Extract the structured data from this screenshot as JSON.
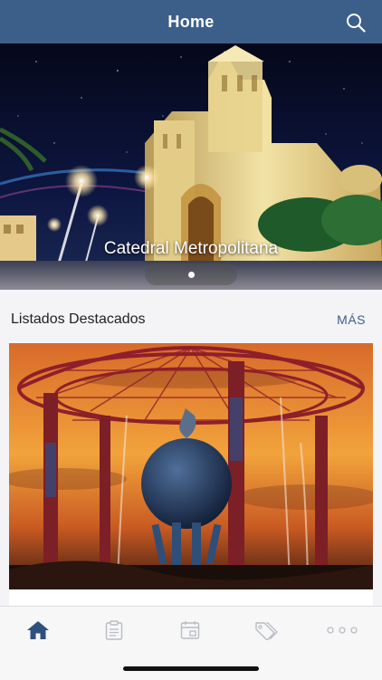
{
  "header": {
    "title": "Home",
    "search_icon": "search-icon"
  },
  "hero": {
    "caption": "Catedral Metropolitana",
    "slides_shown": 1
  },
  "featured": {
    "title": "Listados Destacados",
    "more_label": "MÁS"
  },
  "tabbar": {
    "items": [
      {
        "icon": "home-icon",
        "active": true
      },
      {
        "icon": "clipboard-icon",
        "active": false
      },
      {
        "icon": "calendar-icon",
        "active": false
      },
      {
        "icon": "tags-icon",
        "active": false
      },
      {
        "icon": "more-icon",
        "active": false
      }
    ]
  },
  "colors": {
    "brand": "#3c5f8a",
    "inactive_icon": "#b9bcc4"
  }
}
